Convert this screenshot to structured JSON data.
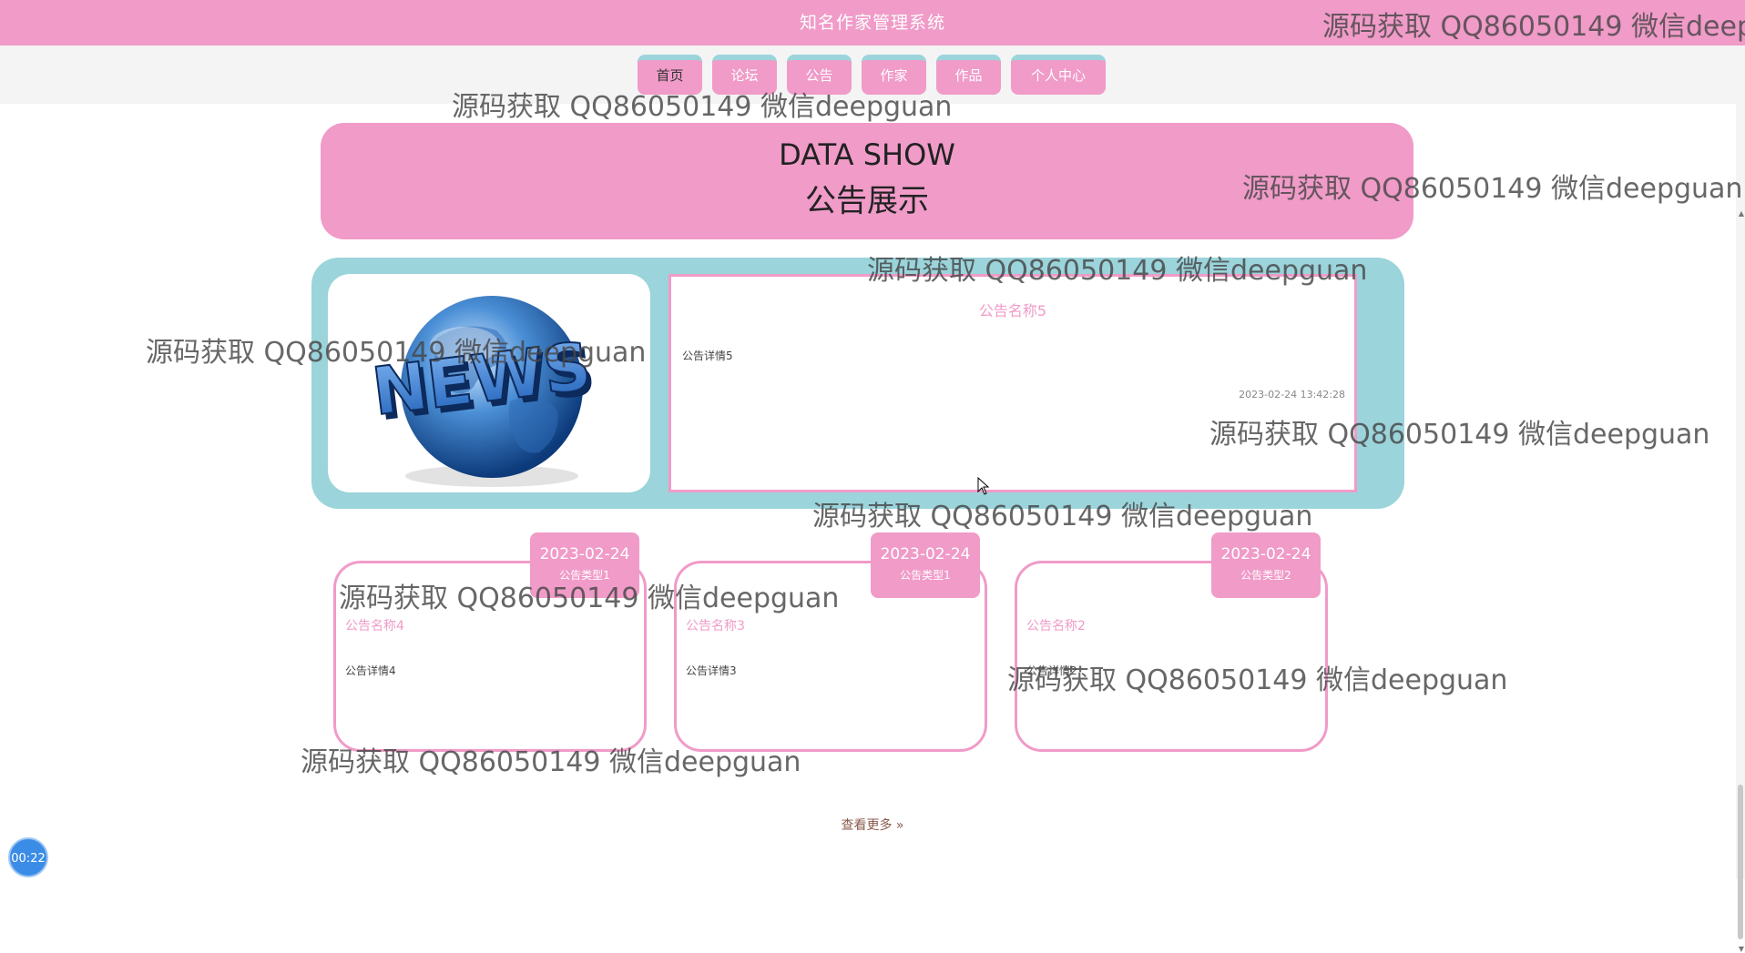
{
  "app": {
    "title": "知名作家管理系统"
  },
  "nav": {
    "items": [
      {
        "label": "首页",
        "active": true
      },
      {
        "label": "论坛"
      },
      {
        "label": "公告"
      },
      {
        "label": "作家"
      },
      {
        "label": "作品"
      },
      {
        "label": "个人中心"
      }
    ]
  },
  "banner": {
    "title_en": "DATA SHOW",
    "title_zh": "公告展示"
  },
  "featured": {
    "title": "公告名称5",
    "detail": "公告详情5",
    "time": "2023-02-24 13:42:28",
    "image_text": "NEWS"
  },
  "cards": [
    {
      "date": "2023-02-24",
      "type": "公告类型1",
      "title": "公告名称4",
      "detail": "公告详情4"
    },
    {
      "date": "2023-02-24",
      "type": "公告类型1",
      "title": "公告名称3",
      "detail": "公告详情3"
    },
    {
      "date": "2023-02-24",
      "type": "公告类型2",
      "title": "公告名称2",
      "detail": "公告详情2"
    }
  ],
  "more": {
    "label": "查看更多 »"
  },
  "timer": {
    "label": "00:22"
  },
  "watermark": {
    "text": "源码获取 QQ86050149 微信deepguan"
  },
  "colors": {
    "pink": "#f09bc8",
    "teal": "#9bd4db",
    "timer_blue": "#3b8ce6"
  }
}
